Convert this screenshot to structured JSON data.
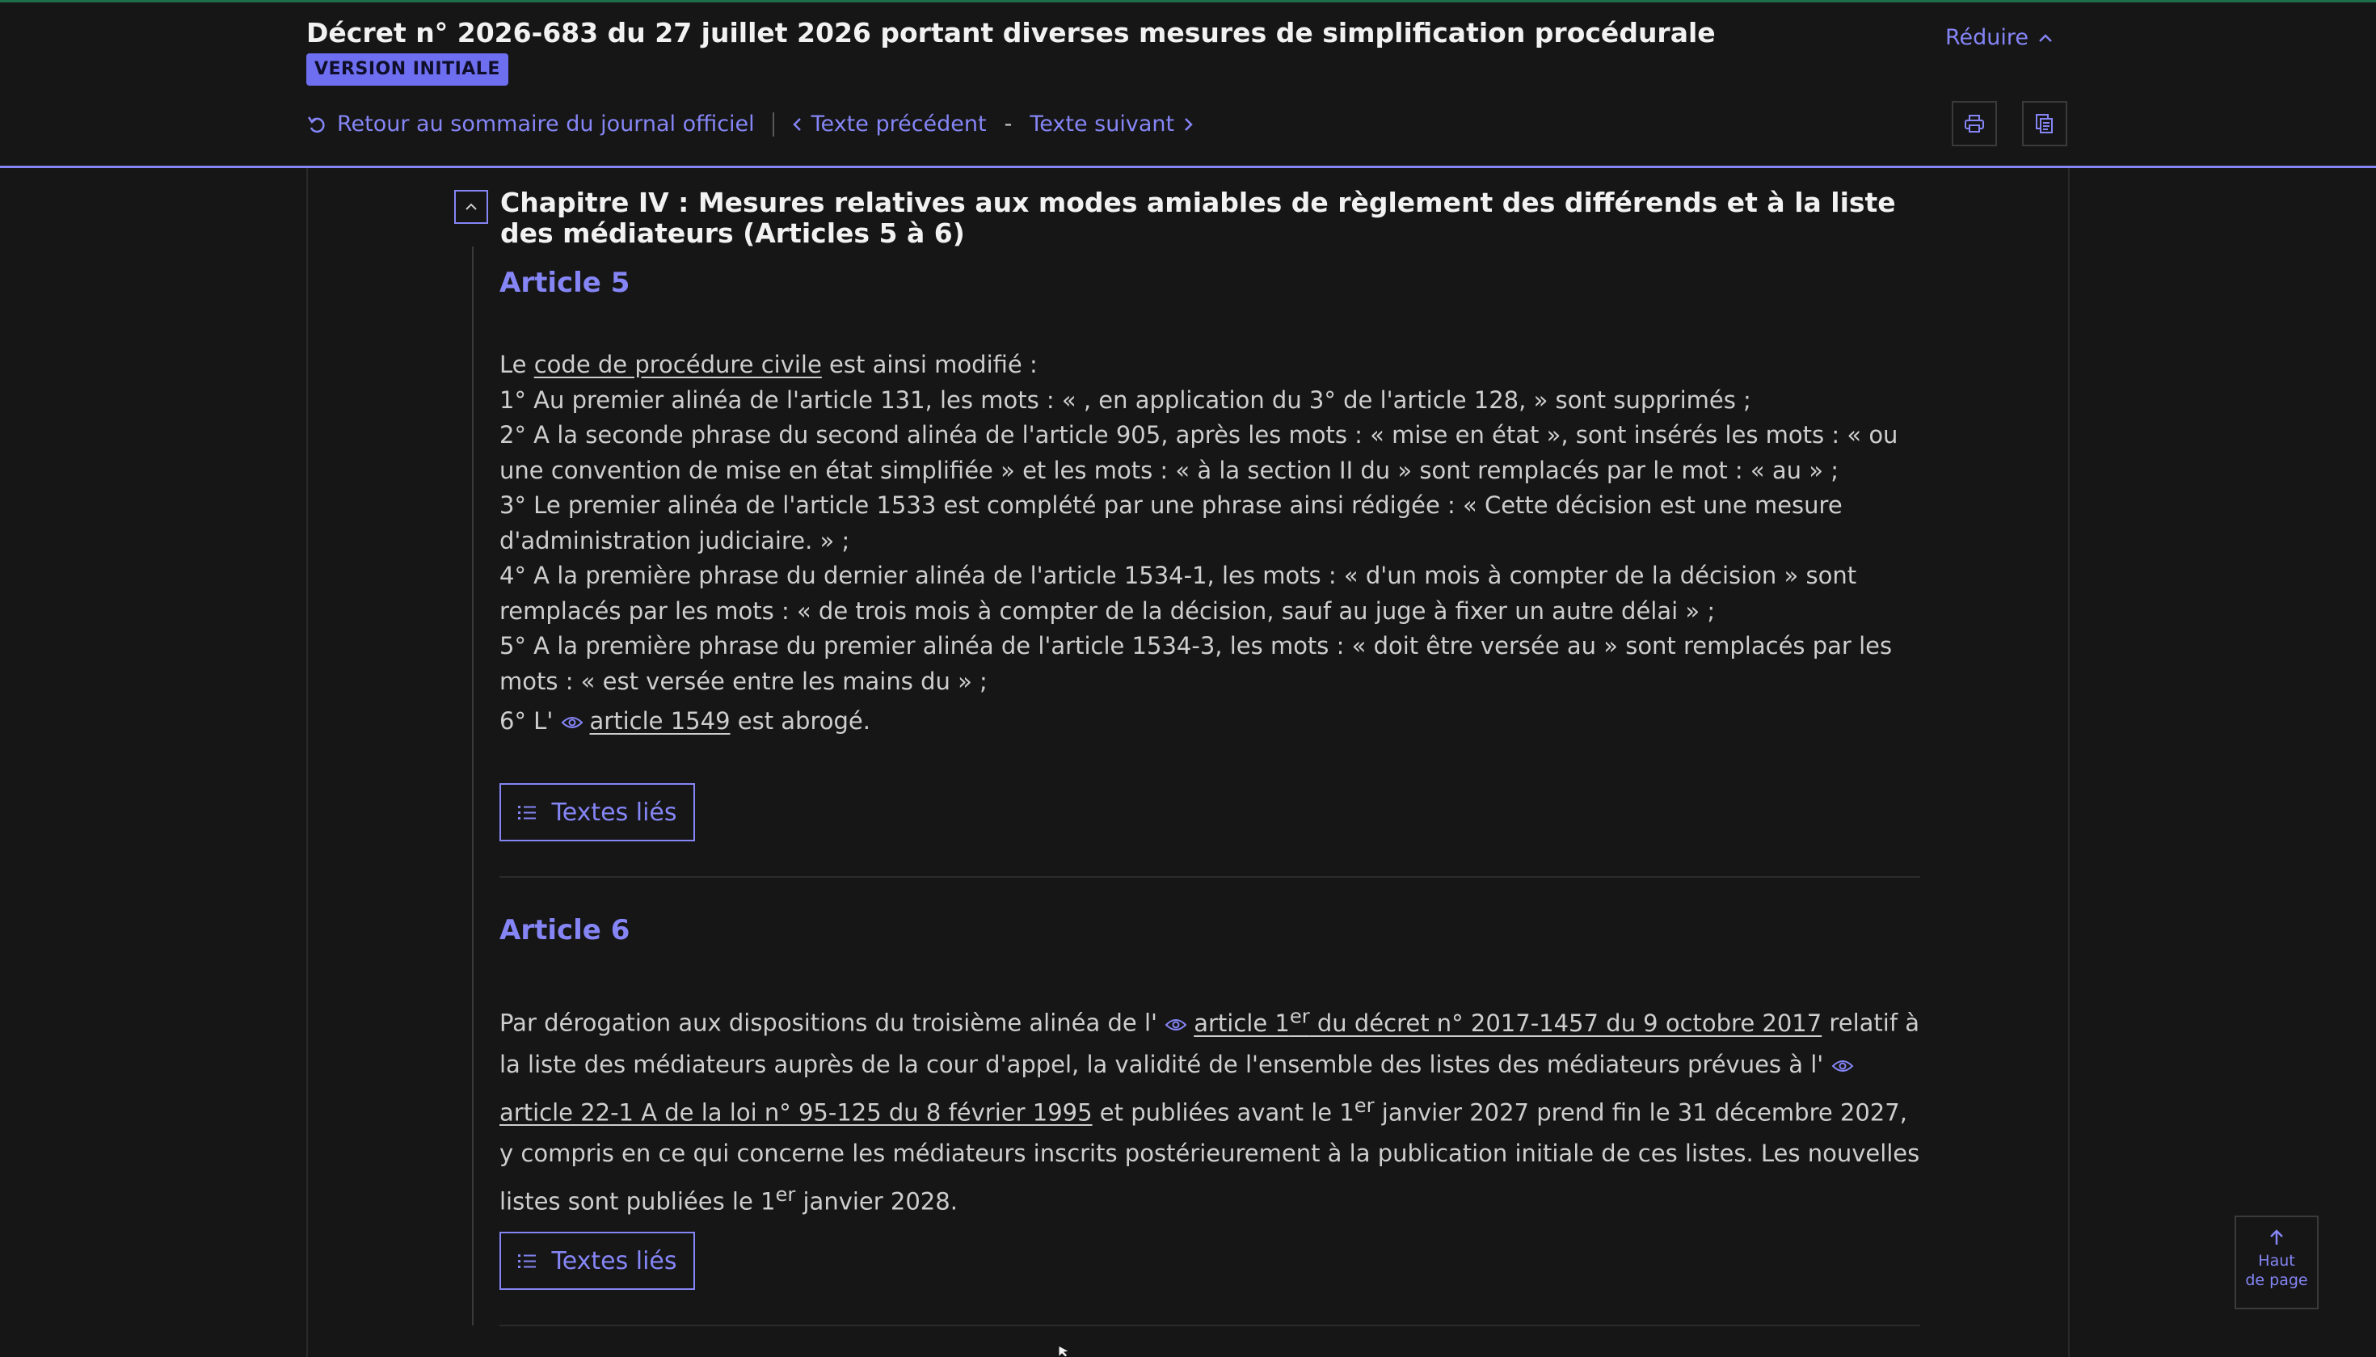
{
  "header": {
    "title": "Décret n° 2026-683 du 27 juillet 2026 portant diverses mesures de simplification procédurale",
    "badge": "VERSION INITIALE",
    "reduce_label": "Réduire",
    "nav": {
      "back": "Retour au sommaire du journal officiel",
      "prev": "Texte précédent",
      "separator": "-",
      "next": "Texte suivant"
    }
  },
  "chapter": {
    "title": "Chapitre IV : Mesures relatives aux modes amiables de règlement des différends et à la liste des médiateurs (Articles 5 à 6)"
  },
  "article5": {
    "heading": "Article 5",
    "intro_pre": "Le ",
    "intro_link": "code de procédure civile",
    "intro_post": " est ainsi modifié :",
    "item1": "1° Au premier alinéa de l'article 131, les mots : « , en application du 3° de l'article 128, » sont supprimés ;",
    "item2": "2° A la seconde phrase du second alinéa de l'article 905, après les mots : « mise en état », sont insérés les mots : « ou une convention de mise en état simplifiée » et les mots : « à la section II du » sont remplacés par le mot : « au » ;",
    "item3": "3° Le premier alinéa de l'article 1533 est complété par une phrase ainsi rédigée : « Cette décision est une mesure d'administration judiciaire. » ;",
    "item4": "4° A la première phrase du dernier alinéa de l'article 1534-1, les mots : « d'un mois à compter de la décision » sont remplacés par les mots : « de trois mois à compter de la décision, sauf au juge à fixer un autre délai » ;",
    "item5": "5° A la première phrase du premier alinéa de l'article 1534-3, les mots : « doit être versée au » sont remplacés par les mots : « est versée entre les mains du » ;",
    "item6_pre": "6° L' ",
    "item6_link": "article 1549",
    "item6_post": " est abrogé.",
    "linked_label": "Textes liés"
  },
  "article6": {
    "heading": "Article 6",
    "t1": "Par dérogation aux dispositions du troisième alinéa de l' ",
    "link1_a": "article 1",
    "link1_sup": "er",
    "link1_b": " du décret n° 2017-1457 du 9 octobre 2017",
    "t2": " relatif à la liste des médiateurs auprès de la cour d'appel, la validité de l'ensemble des listes des médiateurs prévues à l' ",
    "link2": "article 22-1 A de la loi n° 95-125 du 8 février 1995",
    "t3": " et publiées avant le 1",
    "sup2": "er",
    "t4": " janvier 2027 prend fin le 31 décembre 2027, y compris en ce qui concerne les médiateurs inscrits postérieurement à la publication initiale de ces listes. Les nouvelles listes sont publiées le 1",
    "sup3": "er",
    "t5": " janvier 2028.",
    "linked_label": "Textes liés"
  },
  "back_to_top": {
    "line1": "Haut",
    "line2": "de page"
  },
  "colors": {
    "accent": "#8585f6",
    "background": "#161616",
    "text": "#cecece",
    "badge": "#6e6ef0"
  }
}
